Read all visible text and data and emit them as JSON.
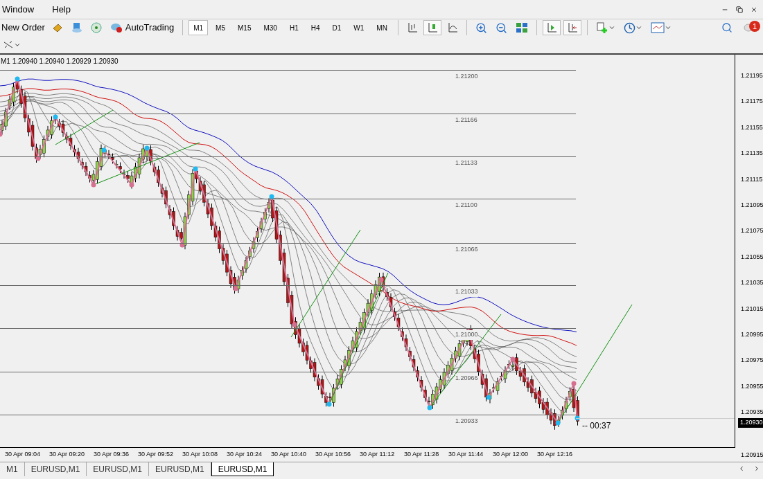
{
  "menu": [
    "Window",
    "Help"
  ],
  "toolbar": {
    "new_order": "New Order",
    "auto_trading": "AutoTrading",
    "notifications": "1"
  },
  "timeframes": [
    {
      "label": "M1",
      "selected": true
    },
    {
      "label": "M5",
      "selected": false
    },
    {
      "label": "M15",
      "selected": false
    },
    {
      "label": "M30",
      "selected": false
    },
    {
      "label": "H1",
      "selected": false
    },
    {
      "label": "H4",
      "selected": false
    },
    {
      "label": "D1",
      "selected": false
    },
    {
      "label": "W1",
      "selected": false
    },
    {
      "label": "MN",
      "selected": false
    }
  ],
  "chart": {
    "header": "M1  1.20940 1.20940 1.20929 1.20930",
    "levels": [
      "1.21200",
      "1.21166",
      "1.21133",
      "1.21100",
      "1.21066",
      "1.21033",
      "1.21000",
      "1.20966",
      "1.20933"
    ],
    "price_axis": [
      "1.21195",
      "1.21175",
      "1.21155",
      "1.21135",
      "1.21115",
      "1.21095",
      "1.21075",
      "1.21055",
      "1.21035",
      "1.21015",
      "1.20995",
      "1.20975",
      "1.20955",
      "1.20935",
      "1.20915"
    ],
    "current_price": "1.20930",
    "countdown": "-- 00:37",
    "time_axis": [
      "30 Apr 09:04",
      "30 Apr 09:20",
      "30 Apr 09:36",
      "30 Apr 09:52",
      "30 Apr 10:08",
      "30 Apr 10:24",
      "30 Apr 10:40",
      "30 Apr 10:56",
      "30 Apr 11:12",
      "30 Apr 11:28",
      "30 Apr 11:44",
      "30 Apr 12:00",
      "30 Apr 12:16"
    ]
  },
  "tabs": [
    {
      "label": "M1",
      "selected": false
    },
    {
      "label": "EURUSD,M1",
      "selected": false
    },
    {
      "label": "EURUSD,M1",
      "selected": false
    },
    {
      "label": "EURUSD,M1",
      "selected": false
    },
    {
      "label": "EURUSD,M1",
      "selected": true
    }
  ]
}
